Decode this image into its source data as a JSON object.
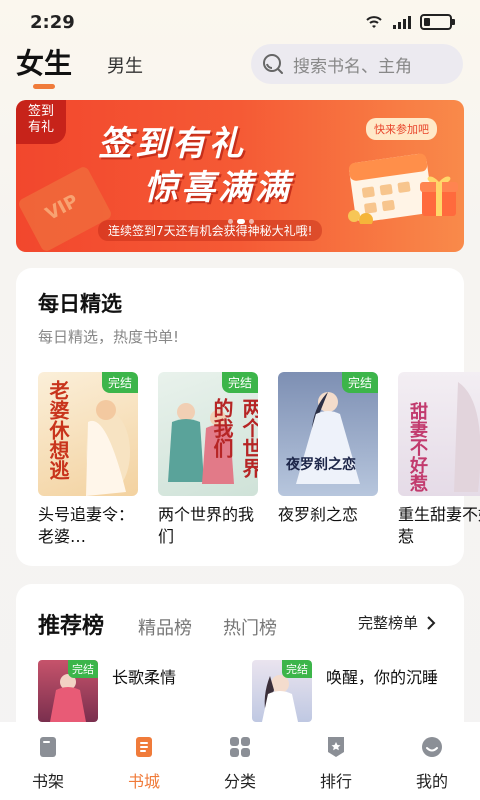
{
  "status": {
    "time": "2:29"
  },
  "header": {
    "tab_female": "女生",
    "tab_male": "男生",
    "search_placeholder": "搜索书名、主角"
  },
  "banner": {
    "corner_line1": "签到",
    "corner_line2": "有礼",
    "title1": "签到有礼",
    "title2": "惊喜满满",
    "cta": "快来参加吧",
    "subtitle": "连续签到7天还有机会获得神秘大礼哦!",
    "vip_text": "VIP"
  },
  "daily": {
    "title": "每日精选",
    "subtitle": "每日精选，热度书单!",
    "books": [
      {
        "title": "头号追妻令：老婆…",
        "badge": "完结",
        "cover_text": "老婆休想逃"
      },
      {
        "title": "两个世界的我们",
        "badge": "完结",
        "cover_text": "两个世界的我们"
      },
      {
        "title": "夜罗刹之恋",
        "badge": "完结",
        "cover_text": "夜罗刹之恋"
      },
      {
        "title": "重生甜妻不好惹",
        "badge": "",
        "cover_text": "甜妻不好惹"
      }
    ]
  },
  "rank": {
    "title": "推荐榜",
    "tab1": "精品榜",
    "tab2": "热门榜",
    "full_list": "完整榜单",
    "items": [
      {
        "title": "长歌柔情",
        "badge": "完结"
      },
      {
        "title": "唤醒，你的沉睡",
        "badge": "完结"
      }
    ]
  },
  "nav": {
    "items": [
      {
        "label": "书架",
        "icon": "bookshelf-icon"
      },
      {
        "label": "书城",
        "icon": "bookstore-icon"
      },
      {
        "label": "分类",
        "icon": "category-icon"
      },
      {
        "label": "排行",
        "icon": "ranking-icon"
      },
      {
        "label": "我的",
        "icon": "profile-icon"
      }
    ],
    "active_index": 1
  },
  "colors": {
    "accent": "#f07b3a",
    "badge_green": "#3cb54a",
    "banner_red": "#f2472d"
  }
}
